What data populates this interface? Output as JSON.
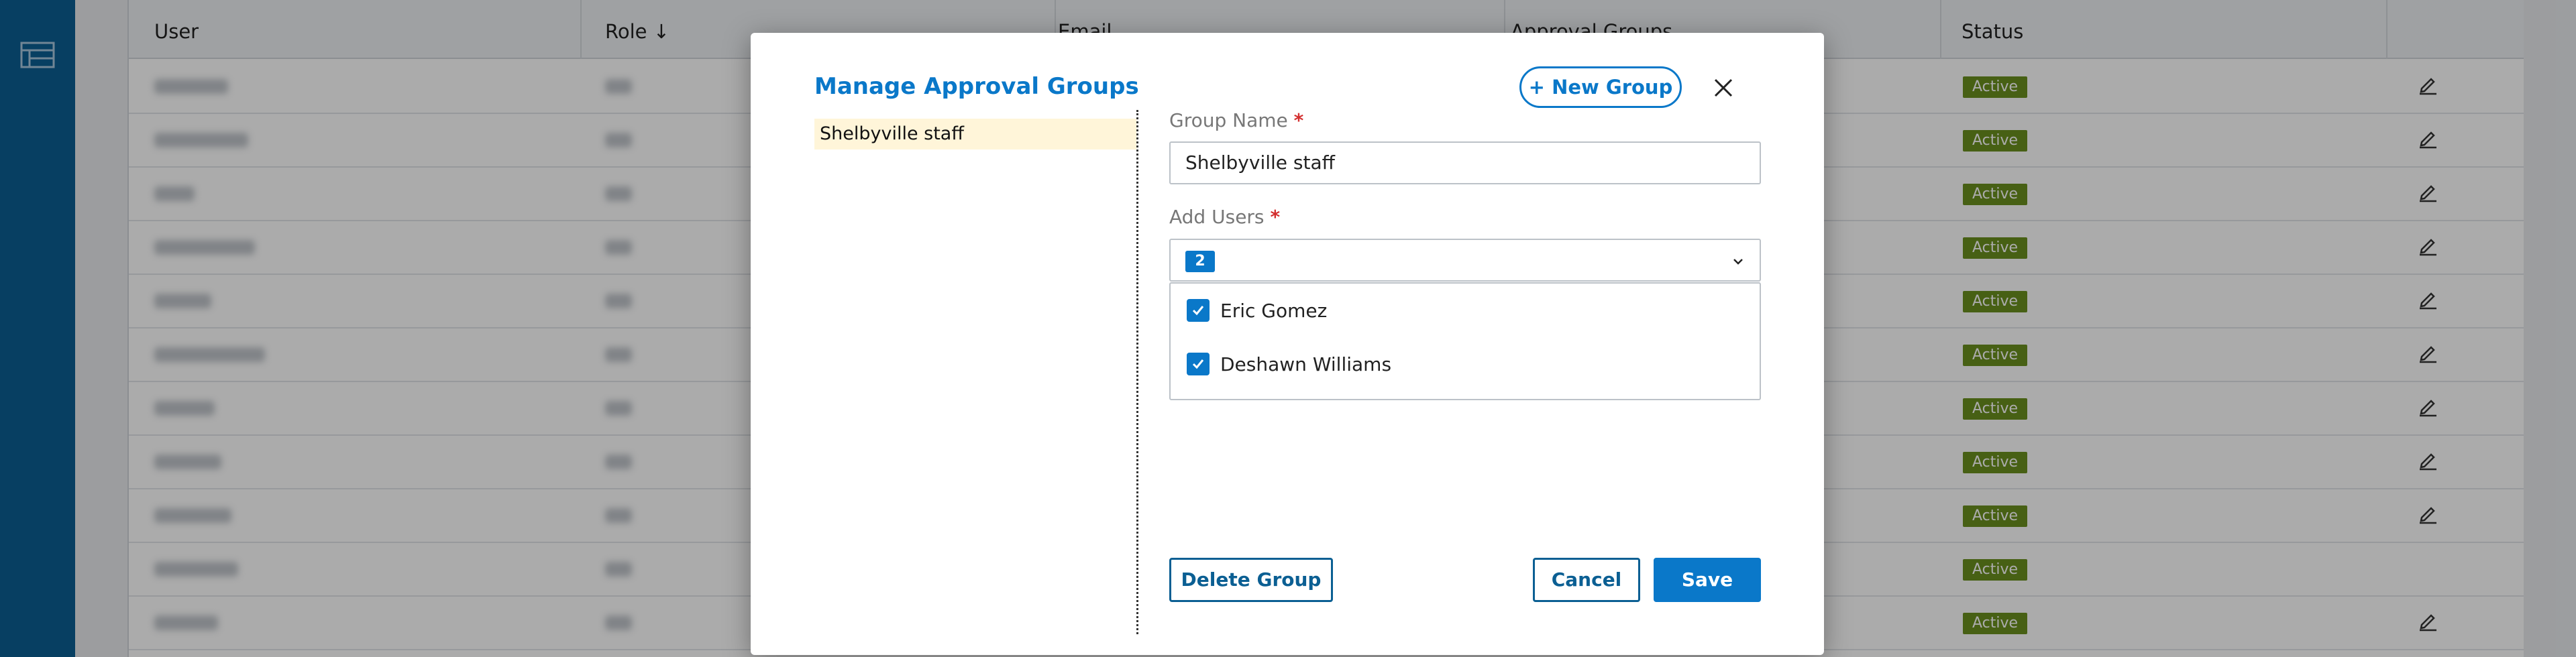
{
  "table": {
    "headers": {
      "user": "User",
      "role": "Role",
      "email": "Email",
      "approval_groups": "Approval Groups",
      "status": "Status"
    },
    "rows": [
      {
        "status": "Active",
        "editable": true
      },
      {
        "status": "Active",
        "editable": true
      },
      {
        "status": "Active",
        "editable": true
      },
      {
        "status": "Active",
        "editable": true
      },
      {
        "status": "Active",
        "editable": true
      },
      {
        "status": "Active",
        "editable": true
      },
      {
        "status": "Active",
        "editable": true
      },
      {
        "status": "Active",
        "editable": true
      },
      {
        "status": "Active",
        "editable": true
      },
      {
        "status": "Active",
        "editable": false
      },
      {
        "status": "Active",
        "editable": true
      }
    ]
  },
  "modal": {
    "title": "Manage Approval Groups",
    "new_group_label": "+ New Group",
    "groups": [
      {
        "name": "Shelbyville staff"
      }
    ],
    "group_name_label": "Group Name",
    "group_name_value": "Shelbyville staff",
    "add_users_label": "Add Users",
    "required_mark": "*",
    "selected_count": "2",
    "users": [
      {
        "name": "Eric Gomez",
        "checked": true
      },
      {
        "name": "Deshawn Williams",
        "checked": true
      }
    ],
    "delete_label": "Delete Group",
    "cancel_label": "Cancel",
    "save_label": "Save"
  },
  "colors": {
    "accent": "#0a78c9",
    "sidebar": "#0b5f93",
    "status_active": "#6a8f1e",
    "selected_item": "#fff5d9"
  },
  "icons": {
    "sidebar": "table-list-icon",
    "close": "close-icon",
    "edit": "pencil-icon",
    "chevron": "chevron-down-icon",
    "check": "checkmark-icon"
  }
}
